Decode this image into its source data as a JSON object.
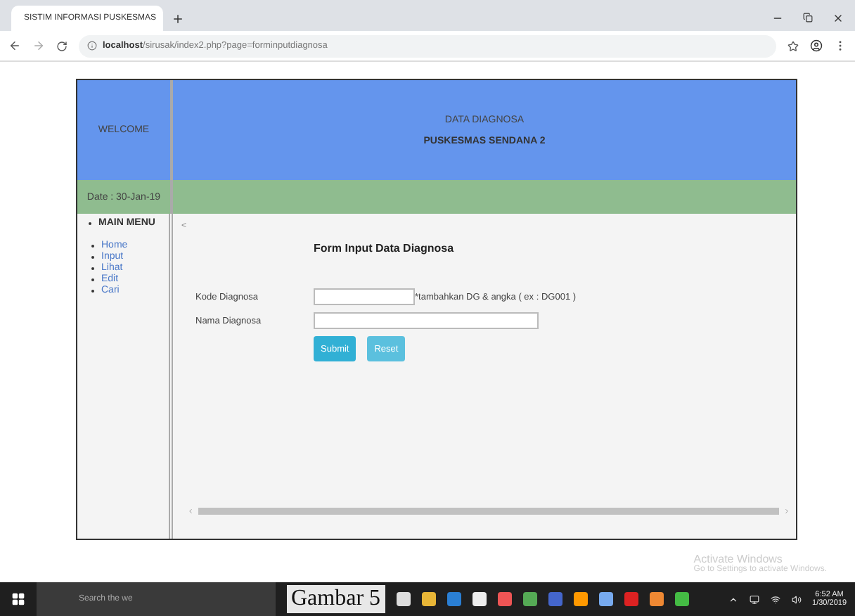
{
  "browser": {
    "tab_title": "SISTIM INFORMASI PUSKESMAS",
    "url_host": "localhost",
    "url_path": "/sirusak/index2.php?page=forminputdiagnosa"
  },
  "header": {
    "welcome": "WELCOME",
    "title": "DATA DIAGNOSA",
    "subtitle": "PUSKESMAS SENDANA 2"
  },
  "date": "Date : 30-Jan-19",
  "sidebar": {
    "heading": "MAIN MENU",
    "items": [
      {
        "label": "Home"
      },
      {
        "label": "Input"
      },
      {
        "label": "Lihat"
      },
      {
        "label": "Edit"
      },
      {
        "label": "Cari"
      }
    ]
  },
  "content": {
    "back": "<",
    "form_title": "Form Input Data Diagnosa",
    "fields": [
      {
        "label": "Kode Diagnosa",
        "hint": "*tambahkan DG & angka ( ex : DG001 )"
      },
      {
        "label": "Nama Diagnosa"
      }
    ],
    "buttons": [
      {
        "label": "Submit",
        "kind": "primary"
      },
      {
        "label": "Reset",
        "kind": "secondary"
      }
    ]
  },
  "activation": {
    "title": "Activate Windows",
    "text": "Go to Settings to activate Windows."
  },
  "taskbar": {
    "search": "Search the we",
    "time": "6:52 AM",
    "date": "1/30/2019"
  },
  "caption": "Gambar 5"
}
